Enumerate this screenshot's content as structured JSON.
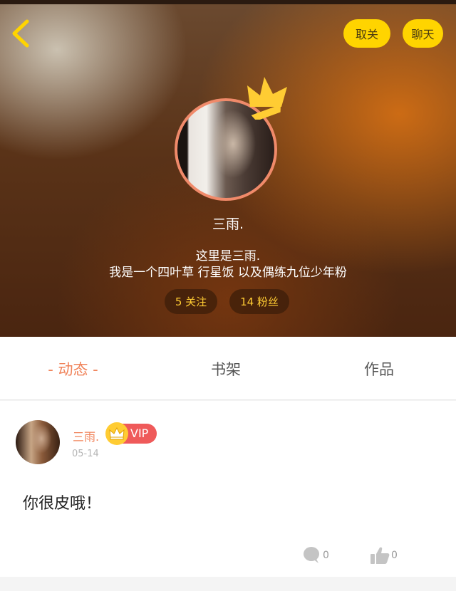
{
  "header": {
    "unfollow_label": "取关",
    "chat_label": "聊天"
  },
  "profile": {
    "nickname": "三雨.",
    "bio_line1": "这里是三雨.",
    "bio_line2": "我是一个四叶草 行星饭 以及偶练九位少年粉",
    "following": "5 关注",
    "fans": "14 粉丝"
  },
  "tabs": {
    "dynamic": "- 动态 -",
    "shelf": "书架",
    "works": "作品"
  },
  "post": {
    "author": "三雨.",
    "vip": "VIP",
    "date": "05-14",
    "content": "你很皮哦！",
    "comment_count": "0",
    "like_count": "0"
  },
  "colors": {
    "accent": "#f0835a",
    "button_yellow": "#ffd400",
    "vip_red": "#ef5a5a",
    "crown_yellow": "#ffcc33"
  },
  "icons": [
    "back-arrow-icon",
    "crown-icon",
    "comment-icon",
    "thumbs-up-icon"
  ]
}
